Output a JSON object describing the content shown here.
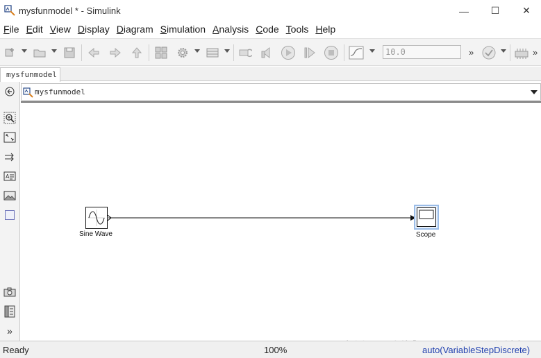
{
  "window": {
    "title": "mysfunmodel * - Simulink",
    "minimize": "—",
    "maximize": "☐",
    "close": "✕"
  },
  "menu": [
    "File",
    "Edit",
    "View",
    "Display",
    "Diagram",
    "Simulation",
    "Analysis",
    "Code",
    "Tools",
    "Help"
  ],
  "toolbar": {
    "stop_time": "10.0",
    "more_1": "»",
    "more_2": "»"
  },
  "tab": {
    "label": "mysfunmodel"
  },
  "address": {
    "path": "mysfunmodel"
  },
  "palette_more": "»",
  "blocks": {
    "sine": {
      "label": "Sine Wave"
    },
    "scope": {
      "label": "Scope"
    }
  },
  "status": {
    "left": "Ready",
    "zoom": "100%",
    "solver": "auto(VariableStepDiscrete)"
  },
  "watermark": "https://blog.csdn.net/jiang",
  "colors": {
    "solver_text": "#1f3fae",
    "selection": "#9bbde8"
  }
}
